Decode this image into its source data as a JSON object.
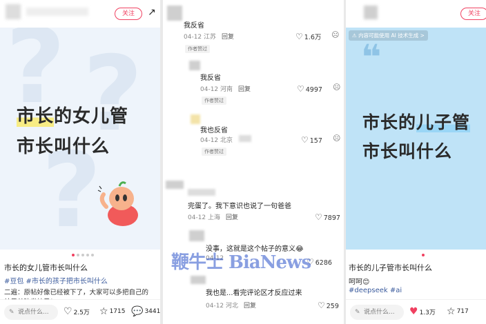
{
  "left": {
    "follow_label": "关注",
    "card_line1_hl": "市长",
    "card_line1_rest": "的女儿管",
    "card_line2": "市长叫什么",
    "post_title": "市长的女儿管市长叫什么",
    "tags": "#豆包 #市长的孩子把市长叫什么",
    "body_line1": "二遍：原帖好像已经被下了，大家可以多把自己的",
    "body_line2": "结果单独发帖子！",
    "say_placeholder": "说点什么...",
    "likes": "2.5万",
    "stars": "1715",
    "comments": "3441"
  },
  "mid": {
    "comments": [
      {
        "text": "我反省",
        "date": "04-12",
        "loc": "江苏",
        "reply": "回复",
        "likes": "1.6万",
        "badge": "作者赞过"
      },
      {
        "text": "我反省",
        "date": "04-12",
        "loc": "河南",
        "reply": "回复",
        "likes": "4997",
        "badge": "作者赞过"
      },
      {
        "text": "我也反省",
        "date": "04-12",
        "loc": "北京",
        "reply": "回复",
        "likes": "157",
        "badge": "作者赞过"
      },
      {
        "text": "完蛋了。我下意识也说了一句爸爸",
        "date": "04-12",
        "loc": "上海",
        "reply": "回复",
        "likes": "7897"
      },
      {
        "text": "没事，这就是这个帖子的意义😂",
        "date": "04-12",
        "loc": "",
        "reply": "",
        "likes": "6286"
      },
      {
        "text": "我也是...看完评论区才反应过来",
        "date": "04-12",
        "loc": "河北",
        "reply": "回复",
        "likes": "259"
      }
    ]
  },
  "right": {
    "follow_label": "关注",
    "ai_note": "内容可能使用 AI 技术生成 >",
    "card_line1_pre": "市长的",
    "card_line1_hl": "儿子管",
    "card_line2": "市长叫什么",
    "post_title": "市长的儿子管市长叫什么",
    "body": "呵呵😊",
    "tags": "#deepseek #ai",
    "say_placeholder": "说点什么...",
    "likes": "1.3万",
    "stars": "717"
  },
  "watermark": "鞭牛士 BiaNews",
  "colors": {
    "accent": "#f04060",
    "tag": "#3b5b9d",
    "card_right_bg": "#bfe3f7",
    "card_left_bg": "#eef4fb"
  }
}
